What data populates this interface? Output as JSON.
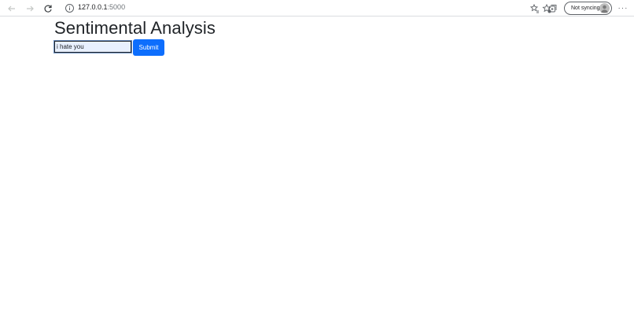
{
  "browser": {
    "url_host": "127.0.0.1",
    "url_port": ":5000",
    "sync_label": "Not syncing",
    "more_label": "···"
  },
  "page": {
    "title": "Sentimental Analysis",
    "input_value": "i hate you",
    "submit_label": "Submit"
  },
  "colors": {
    "submit_bg": "#0d6efd",
    "title_text": "#212529"
  }
}
